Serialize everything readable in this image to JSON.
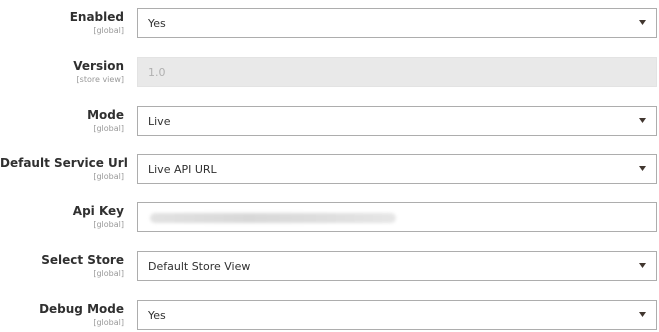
{
  "fields": {
    "enabled": {
      "label": "Enabled",
      "scope": "[global]",
      "value": "Yes"
    },
    "version": {
      "label": "Version",
      "scope": "[store view]",
      "value": "1.0"
    },
    "mode": {
      "label": "Mode",
      "scope": "[global]",
      "value": "Live"
    },
    "service_url": {
      "label": "Default Service Url",
      "scope": "[global]",
      "value": "Live API URL"
    },
    "api_key": {
      "label": "Api Key",
      "scope": "[global]"
    },
    "select_store": {
      "label": "Select Store",
      "scope": "[global]",
      "value": "Default Store View"
    },
    "debug_mode": {
      "label": "Debug Mode",
      "scope": "[global]",
      "value": "Yes"
    }
  },
  "icons": {
    "dropdown": "chevron-down-icon"
  },
  "colors": {
    "border": "#adadad",
    "disabled_bg": "#e9e9e9",
    "scope_text": "#999999",
    "label_text": "#303030"
  }
}
